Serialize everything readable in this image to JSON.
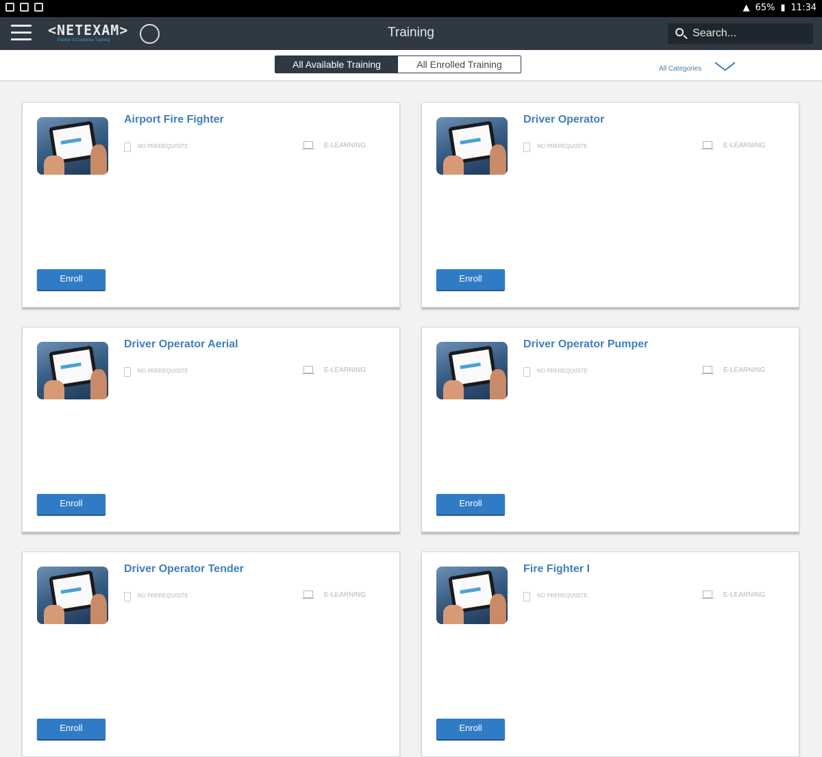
{
  "status_bar": {
    "battery": "65%",
    "time": "11:34"
  },
  "header": {
    "logo_main": "<NETEXAM>",
    "logo_tagline": "Partner & Customer Training",
    "title": "Training",
    "search_placeholder": "Search..."
  },
  "filters": {
    "tabs": [
      {
        "label": "All Available Training",
        "active": true
      },
      {
        "label": "All Enrolled Training",
        "active": false
      }
    ],
    "category_label": "All Categories"
  },
  "courses": [
    {
      "title": "Airport Fire Fighter",
      "prerequisite": "NO PREREQUISITE",
      "type": "E-LEARNING",
      "action": "Enroll"
    },
    {
      "title": "Driver Operator",
      "prerequisite": "NO PREREQUISITE",
      "type": "E-LEARNING",
      "action": "Enroll"
    },
    {
      "title": "Driver Operator Aerial",
      "prerequisite": "NO PREREQUISITE",
      "type": "E-LEARNING",
      "action": "Enroll"
    },
    {
      "title": "Driver Operator Pumper",
      "prerequisite": "NO PREREQUISITE",
      "type": "E-LEARNING",
      "action": "Enroll"
    },
    {
      "title": "Driver Operator Tender",
      "prerequisite": "NO PREREQUISITE",
      "type": "E-LEARNING",
      "action": "Enroll"
    },
    {
      "title": "Fire Fighter I",
      "prerequisite": "NO PREREQUISITE",
      "type": "E-LEARNING",
      "action": "Enroll"
    }
  ],
  "colors": {
    "header_bg": "#2f3943",
    "accent": "#3f7fb9",
    "button": "#2f7bc6"
  }
}
